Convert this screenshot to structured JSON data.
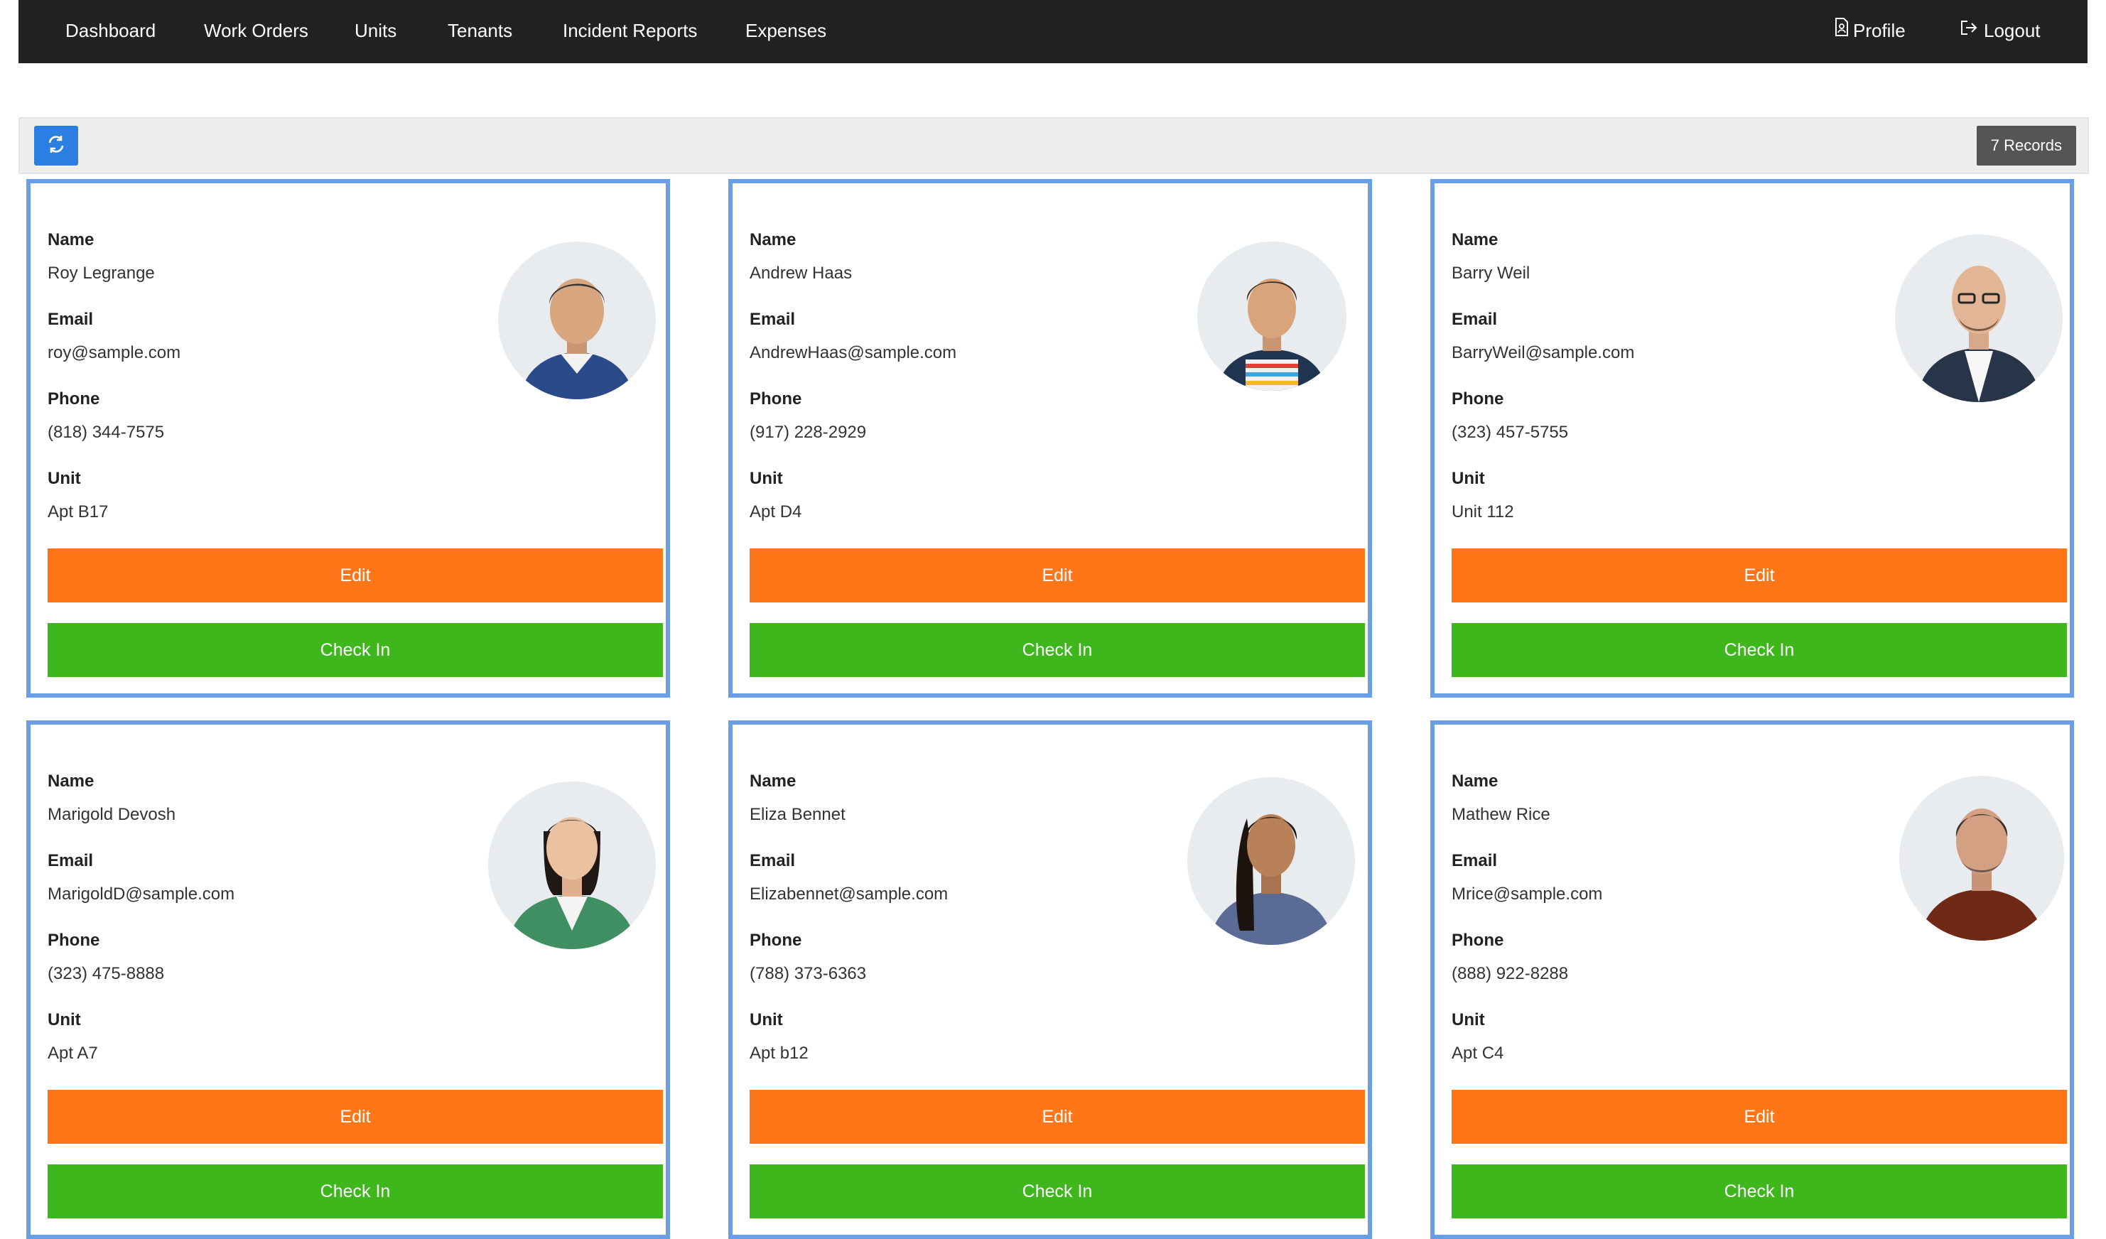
{
  "nav": {
    "items": [
      {
        "label": "Dashboard"
      },
      {
        "label": "Work Orders"
      },
      {
        "label": "Units"
      },
      {
        "label": "Tenants"
      },
      {
        "label": "Incident Reports"
      },
      {
        "label": "Expenses"
      }
    ],
    "profile_label": "Profile",
    "logout_label": "Logout"
  },
  "toolbar": {
    "records_label": "7 Records"
  },
  "labels": {
    "name": "Name",
    "email": "Email",
    "phone": "Phone",
    "unit": "Unit",
    "edit": "Edit",
    "check_in": "Check In"
  },
  "tenants": [
    {
      "name": "Roy Legrange",
      "email": "roy@sample.com",
      "phone": "(818) 344-7575",
      "unit": "Apt B17"
    },
    {
      "name": "Andrew Haas",
      "email": "AndrewHaas@sample.com",
      "phone": "(917) 228-2929",
      "unit": "Apt D4"
    },
    {
      "name": "Barry Weil",
      "email": "BarryWeil@sample.com",
      "phone": "(323) 457-5755",
      "unit": "Unit 112"
    },
    {
      "name": "Marigold Devosh",
      "email": "MarigoldD@sample.com",
      "phone": "(323) 475-8888",
      "unit": "Apt A7"
    },
    {
      "name": "Eliza Bennet",
      "email": "Elizabennet@sample.com",
      "phone": "(788) 373-6363",
      "unit": "Apt b12"
    },
    {
      "name": "Mathew Rice",
      "email": "Mrice@sample.com",
      "phone": "(888) 922-8288",
      "unit": "Apt C4"
    }
  ],
  "colors": {
    "navbar": "#222222",
    "card_border": "#6a9ee6",
    "edit_button": "#ff7619",
    "checkin_button": "#3db71c",
    "refresh_button": "#2b7fe0",
    "records_badge": "#555555"
  }
}
